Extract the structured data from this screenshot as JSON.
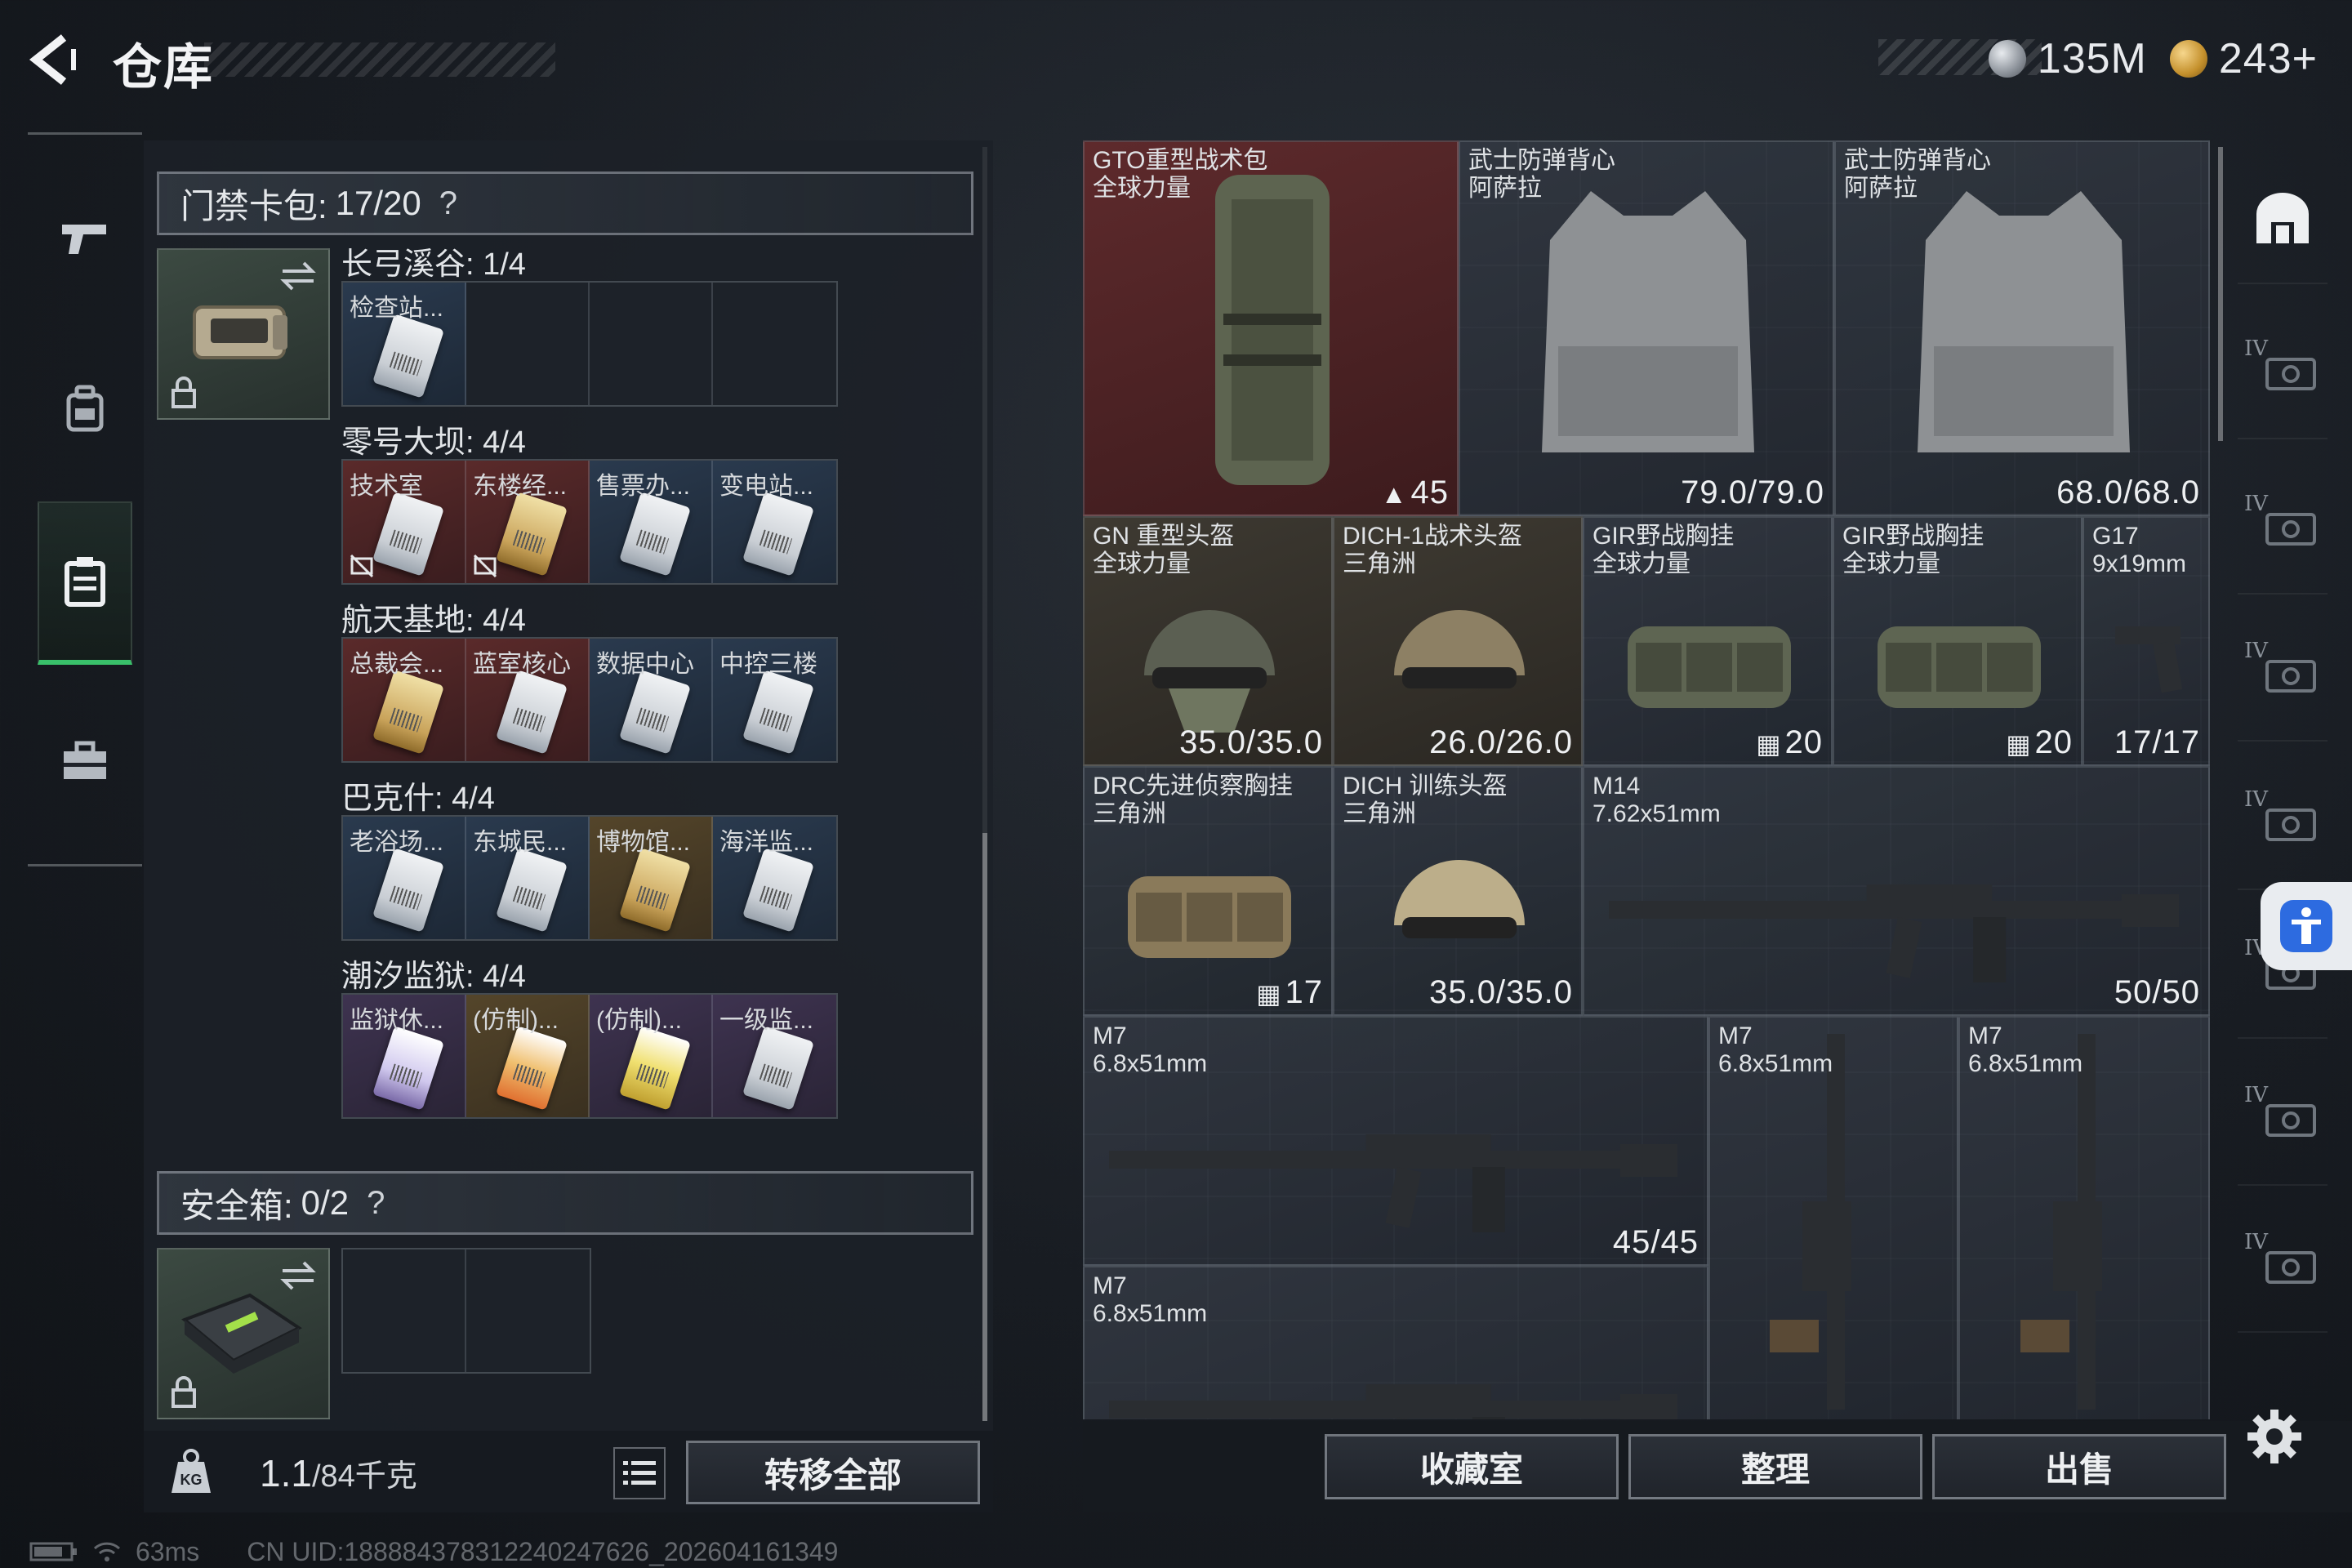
{
  "header": {
    "title": "仓库",
    "currency": [
      {
        "name": "silver-coin",
        "value": "135M"
      },
      {
        "name": "gold-coin",
        "value": "243+"
      }
    ]
  },
  "nav": {
    "items": [
      {
        "icon": "pistol-icon",
        "active": false
      },
      {
        "icon": "backpack-icon",
        "active": false
      },
      {
        "icon": "keycard-holder-icon",
        "active": true
      },
      {
        "icon": "toolbox-icon",
        "active": false
      }
    ]
  },
  "keycard": {
    "header_label": "门禁卡包:",
    "header_count": "17/20",
    "help": "?",
    "zones": [
      {
        "label": "长弓溪谷: 1/4",
        "cards": [
          {
            "name": "检查站...",
            "tone": "blue",
            "art": "white",
            "no_trade": false
          },
          {
            "name": "",
            "tone": "empty"
          },
          {
            "name": "",
            "tone": "empty"
          },
          {
            "name": "",
            "tone": "empty"
          }
        ]
      },
      {
        "label": "零号大坝: 4/4",
        "cards": [
          {
            "name": "技术室",
            "tone": "red",
            "art": "white",
            "no_trade": true
          },
          {
            "name": "东楼经...",
            "tone": "red",
            "art": "gold",
            "no_trade": true
          },
          {
            "name": "售票办...",
            "tone": "blue",
            "art": "white",
            "no_trade": false
          },
          {
            "name": "变电站...",
            "tone": "blue",
            "art": "white",
            "no_trade": false
          }
        ]
      },
      {
        "label": "航天基地: 4/4",
        "cards": [
          {
            "name": "总裁会...",
            "tone": "red",
            "art": "gold",
            "no_trade": false
          },
          {
            "name": "蓝室核心",
            "tone": "red",
            "art": "white",
            "no_trade": false
          },
          {
            "name": "数据中心",
            "tone": "blue",
            "art": "white",
            "no_trade": false
          },
          {
            "name": "中控三楼",
            "tone": "blue",
            "art": "white",
            "no_trade": false
          }
        ]
      },
      {
        "label": "巴克什: 4/4",
        "cards": [
          {
            "name": "老浴场...",
            "tone": "blue",
            "art": "white",
            "no_trade": false
          },
          {
            "name": "东城民...",
            "tone": "blue",
            "art": "white",
            "no_trade": false
          },
          {
            "name": "博物馆...",
            "tone": "gold",
            "art": "gold",
            "no_trade": false
          },
          {
            "name": "海洋监...",
            "tone": "blue",
            "art": "white",
            "no_trade": false
          }
        ]
      },
      {
        "label": "潮汐监狱: 4/4",
        "cards": [
          {
            "name": "监狱休...",
            "tone": "purple",
            "art": "purple",
            "no_trade": false
          },
          {
            "name": "(仿制)...",
            "tone": "gold",
            "art": "orange",
            "no_trade": false
          },
          {
            "name": "(仿制)...",
            "tone": "purple",
            "art": "yellow",
            "no_trade": false
          },
          {
            "name": "一级监...",
            "tone": "purple",
            "art": "white",
            "no_trade": false
          }
        ]
      }
    ]
  },
  "safebox": {
    "header_label": "安全箱:",
    "header_count": "0/2",
    "help": "?"
  },
  "bottom_left": {
    "weight_value": "1.1",
    "weight_max": "/84千克",
    "transfer_label": "转移全部"
  },
  "grid_items": [
    {
      "name": "GTO重型战术包",
      "sub": "全球力量",
      "stat": "45",
      "stat_icon": "lock",
      "tone": "red",
      "art": "backpack"
    },
    {
      "name": "武士防弹背心",
      "sub": "阿萨拉",
      "stat": "79.0/79.0",
      "tone": "gray",
      "art": "vest"
    },
    {
      "name": "武士防弹背心",
      "sub": "阿萨拉",
      "stat": "68.0/68.0",
      "tone": "gray",
      "art": "vest"
    },
    {
      "name": "GN 重型头盔",
      "sub": "全球力量",
      "stat": "35.0/35.0",
      "tone": "brown",
      "art": "helmet-mask"
    },
    {
      "name": "DICH-1战术头盔",
      "sub": "三角洲",
      "stat": "26.0/26.0",
      "tone": "brown",
      "art": "helmet"
    },
    {
      "name": "GIR野战胸挂",
      "sub": "全球力量",
      "stat": "20",
      "stat_icon": "grid",
      "tone": "gray",
      "art": "rig"
    },
    {
      "name": "GIR野战胸挂",
      "sub": "全球力量",
      "stat": "20",
      "stat_icon": "grid",
      "tone": "gray",
      "art": "rig"
    },
    {
      "name": "G17",
      "sub": "9x19mm",
      "stat": "17/17",
      "tone": "gray",
      "art": "pistol"
    },
    {
      "name": "DRC先进侦察胸挂",
      "sub": "三角洲",
      "stat": "17",
      "stat_icon": "grid",
      "tone": "gray",
      "art": "rig-tan"
    },
    {
      "name": "DICH 训练头盔",
      "sub": "三角洲",
      "stat": "35.0/35.0",
      "tone": "gray",
      "art": "helmet-tan"
    },
    {
      "name": "M14",
      "sub": "7.62x51mm",
      "stat": "50/50",
      "tone": "gray",
      "art": "rifle"
    },
    {
      "name": "M7",
      "sub": "6.8x51mm",
      "stat": "45/45",
      "tone": "gray",
      "art": "rifle"
    },
    {
      "name": "M7",
      "sub": "6.8x51mm",
      "stat": "",
      "tone": "gray",
      "art": "rifle-vertical"
    },
    {
      "name": "M7",
      "sub": "6.8x51mm",
      "stat": "",
      "tone": "gray",
      "art": "rifle-vertical"
    },
    {
      "name": "M7",
      "sub": "6.8x51mm",
      "stat": "",
      "tone": "gray",
      "art": "rifle"
    }
  ],
  "bottom_right": {
    "favorites_label": "收藏室",
    "sort_label": "整理",
    "sell_label": "出售"
  },
  "right_rail": {
    "tier_label": "IV",
    "items": [
      "armory-icon",
      "iv-folder-icon",
      "iv-case-icon",
      "iv-case-icon",
      "iv-case-icon",
      "iv-case-icon",
      "iv-case-icon",
      "iv-case-icon",
      "iv-case-icon"
    ]
  },
  "status": {
    "ping": "63ms",
    "uid": "CN UID:1888843783122402476​26_202604161349"
  },
  "colors": {
    "accent_green": "#39c06a",
    "accessibility_blue": "#2d6be0"
  }
}
